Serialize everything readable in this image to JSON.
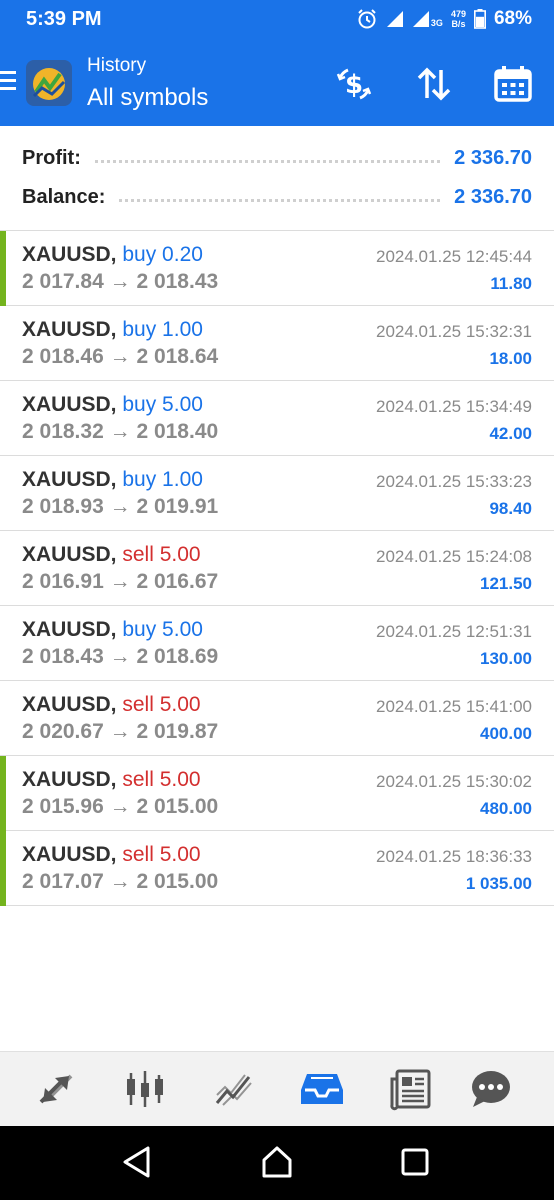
{
  "status_bar": {
    "time": "5:39 PM",
    "net_type": "3G",
    "speed_value": "479",
    "speed_unit": "B/s",
    "battery": "68%"
  },
  "header": {
    "subtitle": "History",
    "title": "All symbols",
    "icons": [
      "menu-icon",
      "metatrader-logo",
      "dollar-filter-icon",
      "sort-icon",
      "calendar-icon"
    ]
  },
  "summary": {
    "profit_label": "Profit:",
    "profit_value": "2 336.70",
    "balance_label": "Balance:",
    "balance_value": "2 336.70"
  },
  "trades": [
    {
      "symbol": "XAUUSD,",
      "type": "buy 0.20",
      "side": "buy",
      "open": "2 017.84",
      "close": "2 018.43",
      "date": "2024.01.25 12:45:44",
      "profit": "11.80",
      "marked": true
    },
    {
      "symbol": "XAUUSD,",
      "type": "buy 1.00",
      "side": "buy",
      "open": "2 018.46",
      "close": "2 018.64",
      "date": "2024.01.25 15:32:31",
      "profit": "18.00",
      "marked": false
    },
    {
      "symbol": "XAUUSD,",
      "type": "buy 5.00",
      "side": "buy",
      "open": "2 018.32",
      "close": "2 018.40",
      "date": "2024.01.25 15:34:49",
      "profit": "42.00",
      "marked": false
    },
    {
      "symbol": "XAUUSD,",
      "type": "buy 1.00",
      "side": "buy",
      "open": "2 018.93",
      "close": "2 019.91",
      "date": "2024.01.25 15:33:23",
      "profit": "98.40",
      "marked": false
    },
    {
      "symbol": "XAUUSD,",
      "type": "sell 5.00",
      "side": "sell",
      "open": "2 016.91",
      "close": "2 016.67",
      "date": "2024.01.25 15:24:08",
      "profit": "121.50",
      "marked": false
    },
    {
      "symbol": "XAUUSD,",
      "type": "buy 5.00",
      "side": "buy",
      "open": "2 018.43",
      "close": "2 018.69",
      "date": "2024.01.25 12:51:31",
      "profit": "130.00",
      "marked": false
    },
    {
      "symbol": "XAUUSD,",
      "type": "sell 5.00",
      "side": "sell",
      "open": "2 020.67",
      "close": "2 019.87",
      "date": "2024.01.25 15:41:00",
      "profit": "400.00",
      "marked": false
    },
    {
      "symbol": "XAUUSD,",
      "type": "sell 5.00",
      "side": "sell",
      "open": "2 015.96",
      "close": "2 015.00",
      "date": "2024.01.25 15:30:02",
      "profit": "480.00",
      "marked": true
    },
    {
      "symbol": "XAUUSD,",
      "type": "sell 5.00",
      "side": "sell",
      "open": "2 017.07",
      "close": "2 015.00",
      "date": "2024.01.25 18:36:33",
      "profit": "1 035.00",
      "marked": true
    }
  ],
  "arrow": "→",
  "bottom_nav": [
    "quotes-icon",
    "chart-icon",
    "trade-icon",
    "history-icon",
    "news-icon",
    "chat-icon"
  ],
  "bottom_nav_active": "history-icon",
  "colors": {
    "accent": "#1a73e8",
    "sell": "#d32f2f",
    "marker": "#74b41e",
    "muted": "#8a8a8a"
  }
}
